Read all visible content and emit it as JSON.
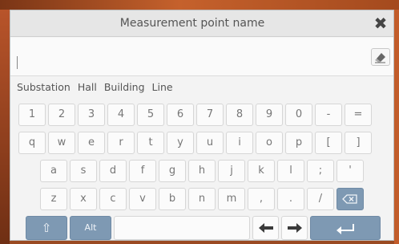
{
  "dialog": {
    "title": "Measurement point name",
    "close_icon": "close-icon",
    "input_value": "",
    "clear_icon": "eraser-icon"
  },
  "suggestions": [
    "Substation",
    "Hall",
    "Building",
    "Line"
  ],
  "keyboard": {
    "row1": [
      "1",
      "2",
      "3",
      "4",
      "5",
      "6",
      "7",
      "8",
      "9",
      "0",
      "-",
      "="
    ],
    "row2": [
      "q",
      "w",
      "e",
      "r",
      "t",
      "y",
      "u",
      "i",
      "o",
      "p",
      "[",
      "]"
    ],
    "row3": [
      "a",
      "s",
      "d",
      "f",
      "g",
      "h",
      "j",
      "k",
      "l",
      ";",
      "'"
    ],
    "row4": [
      "z",
      "x",
      "c",
      "v",
      "b",
      "n",
      "m",
      ",",
      ".",
      "/"
    ],
    "backspace_icon": "backspace-icon",
    "shift_label": "⇧",
    "alt_label": "Alt",
    "left_arrow_icon": "arrow-left-icon",
    "right_arrow_icon": "arrow-right-icon",
    "enter_icon": "enter-icon"
  },
  "colors": {
    "accent": "#7e99b3",
    "background": "#f3f3f3",
    "key": "#fbfbfb"
  }
}
